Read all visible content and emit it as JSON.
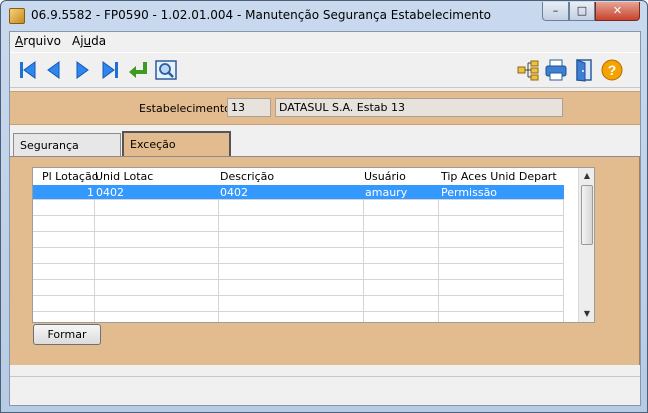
{
  "window": {
    "title": "06.9.5582 - FP0590 - 1.02.01.004 - Manutenção Segurança Estabelecimento",
    "min_glyph": "–",
    "max_glyph": "□",
    "close_glyph": "✕"
  },
  "menu": {
    "arquivo_u": "A",
    "arquivo_rest": "rquivo",
    "ajuda_pre": "Aj",
    "ajuda_u": "u",
    "ajuda_post": "da"
  },
  "toolbar": {
    "left_icons": [
      "first-record-icon",
      "previous-record-icon",
      "next-record-icon",
      "last-record-icon",
      "go-to-icon",
      "search-icon"
    ],
    "right_icons": [
      "hierarchy-icon",
      "print-icon",
      "exit-door-icon",
      "help-icon"
    ],
    "help_glyph": "?"
  },
  "header": {
    "estab_label": "Estabelecimento:",
    "estab_code": "13",
    "estab_name": "DATASUL S.A. Estab 13"
  },
  "tabs": [
    {
      "label": "Segurança"
    },
    {
      "label": "Exceção"
    }
  ],
  "grid": {
    "columns": [
      "Pl Lotação",
      "Unid Lotac",
      "Descrição",
      "Usuário",
      "Tip Aces Unid Depart"
    ],
    "rows": [
      {
        "pl_lotacao": "1",
        "unid_lotac": "0402",
        "descricao": "0402",
        "usuario": "amaury",
        "tip_aces": "Permissão"
      }
    ]
  },
  "buttons": {
    "formar": "Formar"
  },
  "colors": {
    "panel_tan": "#e2bc8f",
    "selection": "#3399ff"
  }
}
